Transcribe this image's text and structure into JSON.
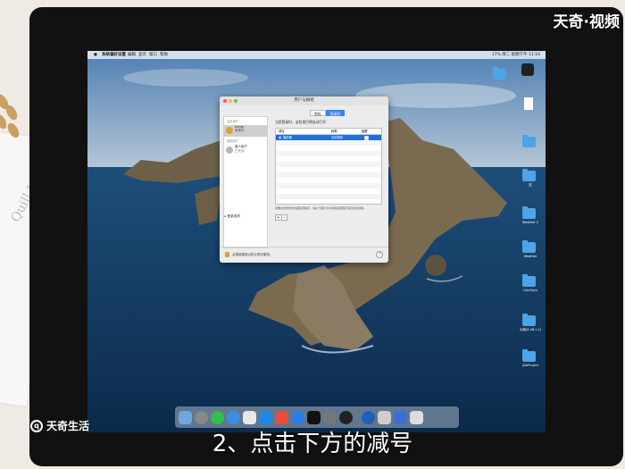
{
  "video": {
    "watermark_top": "天奇·视频",
    "watermark_left": "天奇生活",
    "caption": "2、点击下方的减号"
  },
  "menubar": {
    "apple": "",
    "app": "系统偏好设置",
    "menus": [
      "编辑",
      "显示",
      "窗口",
      "帮助"
    ],
    "right": "17% 周二 星期下午 11:16"
  },
  "desktop_icons": [
    {
      "label": ""
    },
    {
      "label": ""
    },
    {
      "label": ""
    },
    {
      "label": "宏"
    },
    {
      "label": ""
    },
    {
      "label": "Weather 2"
    },
    {
      "label": "Weather"
    },
    {
      "label": "UserSym"
    },
    {
      "label": "大鹅(6.46.1.1)"
    },
    {
      "label": "JJ2bProject"
    }
  ],
  "window": {
    "title": "用户与群组",
    "tabs": [
      "密码",
      "登录项"
    ],
    "active_tab": "登录项",
    "sidebar": {
      "section_current": "当前用户",
      "current_user": {
        "name": "tianqi",
        "role": "管理员"
      },
      "section_other": "其他用户",
      "other_user": {
        "name": "客人用户",
        "role": "已关闭"
      },
      "login_options": "登录选项"
    },
    "description": "当您登录时，这些项目将自动打开：",
    "table": {
      "headers": [
        "项目",
        "种类",
        "隐藏"
      ],
      "rows": [
        {
          "item": "播放器",
          "kind": "应用程序",
          "hidden": ""
        }
      ]
    },
    "hint": "若要在您登录时隐藏应用程序，请在“隐藏”栏中选择应用程序旁边的复选框。",
    "plus": "+",
    "minus": "−",
    "lock_text": "点按锁按钮以防止再次更改。",
    "help": "?"
  },
  "colors": {
    "accent": "#3b82f6",
    "selection": "#1f6fe0",
    "folder": "#4fa3e8"
  }
}
